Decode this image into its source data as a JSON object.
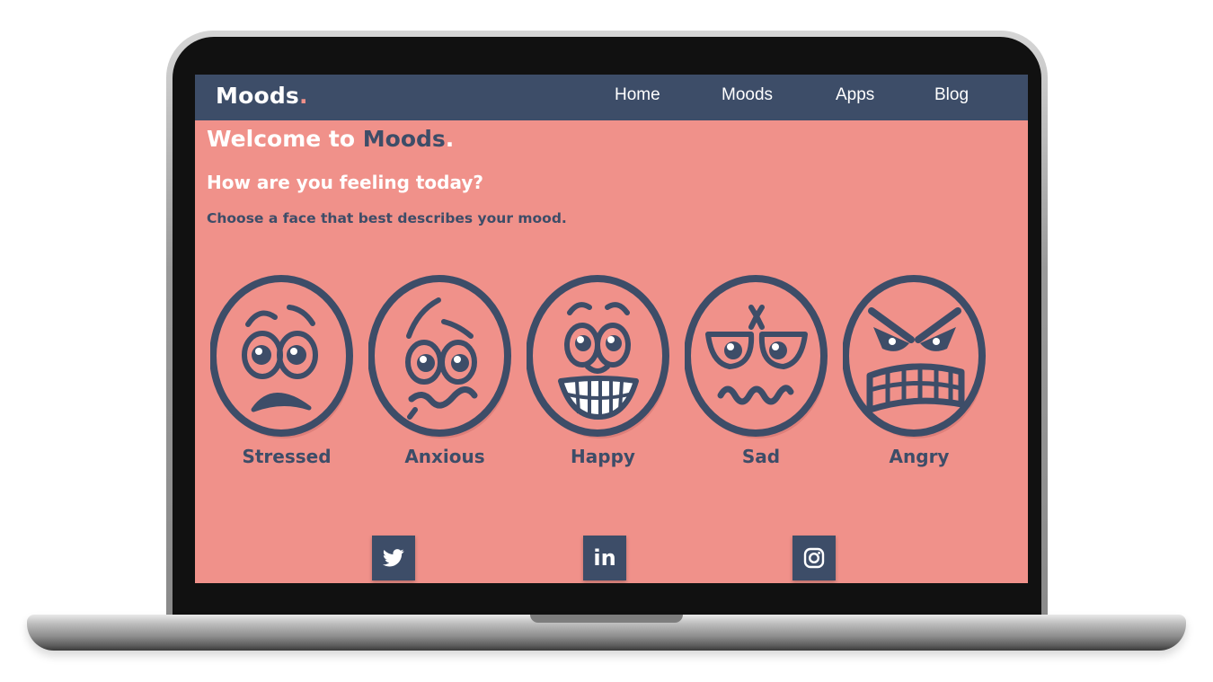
{
  "nav": {
    "logo_text": "Moods",
    "logo_dot": ".",
    "links": [
      "Home",
      "Moods",
      "Apps",
      "Blog"
    ]
  },
  "hero": {
    "welcome_prefix": "Welcome to",
    "welcome_brand": "Moods",
    "welcome_dot": ".",
    "question": "How are you feeling today?",
    "instruction": "Choose a face that best describes your mood."
  },
  "moods": [
    {
      "label": "Stressed",
      "icon": "stressed-face-icon"
    },
    {
      "label": "Anxious",
      "icon": "anxious-face-icon"
    },
    {
      "label": "Happy",
      "icon": "happy-face-icon"
    },
    {
      "label": "Sad",
      "icon": "sad-face-icon"
    },
    {
      "label": "Angry",
      "icon": "angry-face-icon"
    }
  ],
  "social": [
    {
      "icon": "twitter-icon"
    },
    {
      "icon": "linkedin-icon",
      "text": "in"
    },
    {
      "icon": "instagram-icon"
    }
  ],
  "colors": {
    "page_background": "#f0918a",
    "navy": "#3d4d68",
    "white": "#ffffff"
  }
}
